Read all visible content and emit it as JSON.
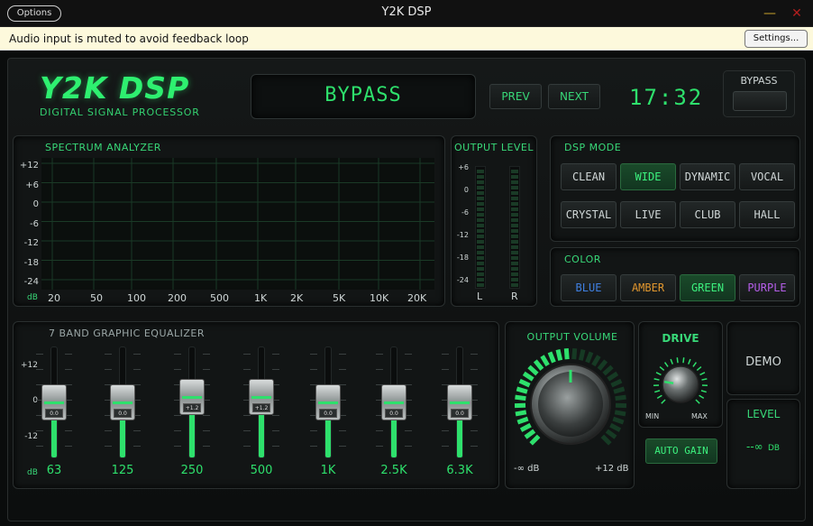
{
  "window": {
    "title": "Y2K DSP",
    "options_label": "Options",
    "minimize_glyph": "—",
    "close_glyph": "✕"
  },
  "notification": {
    "text": "Audio input is muted to avoid feedback loop",
    "settings_label": "Settings..."
  },
  "header": {
    "logo": "Y2K DSP",
    "logo_sub": "DIGITAL SIGNAL PROCESSOR",
    "display": "BYPASS",
    "prev_label": "PREV",
    "next_label": "NEXT",
    "clock": "17:32",
    "bypass_label": "BYPASS"
  },
  "spectrum": {
    "title": "SPECTRUM ANALYZER",
    "db_label": "dB",
    "y_ticks": [
      "+12",
      "+6",
      "0",
      "-6",
      "-12",
      "-18",
      "-24"
    ],
    "x_ticks": [
      "20",
      "50",
      "100",
      "200",
      "500",
      "1K",
      "2K",
      "5K",
      "10K",
      "20K"
    ]
  },
  "output_level": {
    "title": "OUTPUT LEVEL",
    "y_ticks": [
      "+6",
      "0",
      "-6",
      "-12",
      "-18",
      "-24"
    ],
    "left_label": "L",
    "right_label": "R"
  },
  "dsp_mode": {
    "title": "DSP MODE",
    "modes": [
      {
        "label": "CLEAN",
        "active": false
      },
      {
        "label": "WIDE",
        "active": true
      },
      {
        "label": "DYNAMIC",
        "active": false
      },
      {
        "label": "VOCAL",
        "active": false
      },
      {
        "label": "CRYSTAL",
        "active": false
      },
      {
        "label": "LIVE",
        "active": false
      },
      {
        "label": "CLUB",
        "active": false
      },
      {
        "label": "HALL",
        "active": false
      }
    ]
  },
  "color": {
    "title": "COLOR",
    "options": [
      {
        "label": "BLUE",
        "color": "#3f7fe0",
        "active": false
      },
      {
        "label": "AMBER",
        "color": "#e0962e",
        "active": false
      },
      {
        "label": "GREEN",
        "color": "#3cf07e",
        "active": true
      },
      {
        "label": "PURPLE",
        "color": "#b45ee8",
        "active": false
      }
    ]
  },
  "equalizer": {
    "title": "7 BAND GRAPHIC EQUALIZER",
    "db_label": "dB",
    "y_ticks": [
      "+12",
      "0",
      "-12"
    ],
    "bands": [
      {
        "freq": "63",
        "value": "0.0",
        "level": 0.5
      },
      {
        "freq": "125",
        "value": "0.0",
        "level": 0.5
      },
      {
        "freq": "250",
        "value": "+1.2",
        "level": 0.55
      },
      {
        "freq": "500",
        "value": "+1.2",
        "level": 0.55
      },
      {
        "freq": "1K",
        "value": "0.0",
        "level": 0.5
      },
      {
        "freq": "2.5K",
        "value": "0.0",
        "level": 0.5
      },
      {
        "freq": "6.3K",
        "value": "0.0",
        "level": 0.5
      }
    ]
  },
  "output_volume": {
    "title": "OUTPUT VOLUME",
    "min_label": "-∞ dB",
    "max_label": "+12 dB",
    "level": 0.5
  },
  "drive": {
    "title": "DRIVE",
    "min_label": "MIN",
    "max_label": "MAX",
    "auto_gain_label": "AUTO GAIN",
    "level": 0.2
  },
  "demo": {
    "label": "DEMO"
  },
  "level": {
    "title": "LEVEL",
    "value": "--∞",
    "unit": "DB"
  },
  "colors": {
    "accent": "#2ee06c",
    "background": "#0a0c0c"
  },
  "icons": {
    "minimize": "minimize-icon",
    "close": "close-icon"
  }
}
